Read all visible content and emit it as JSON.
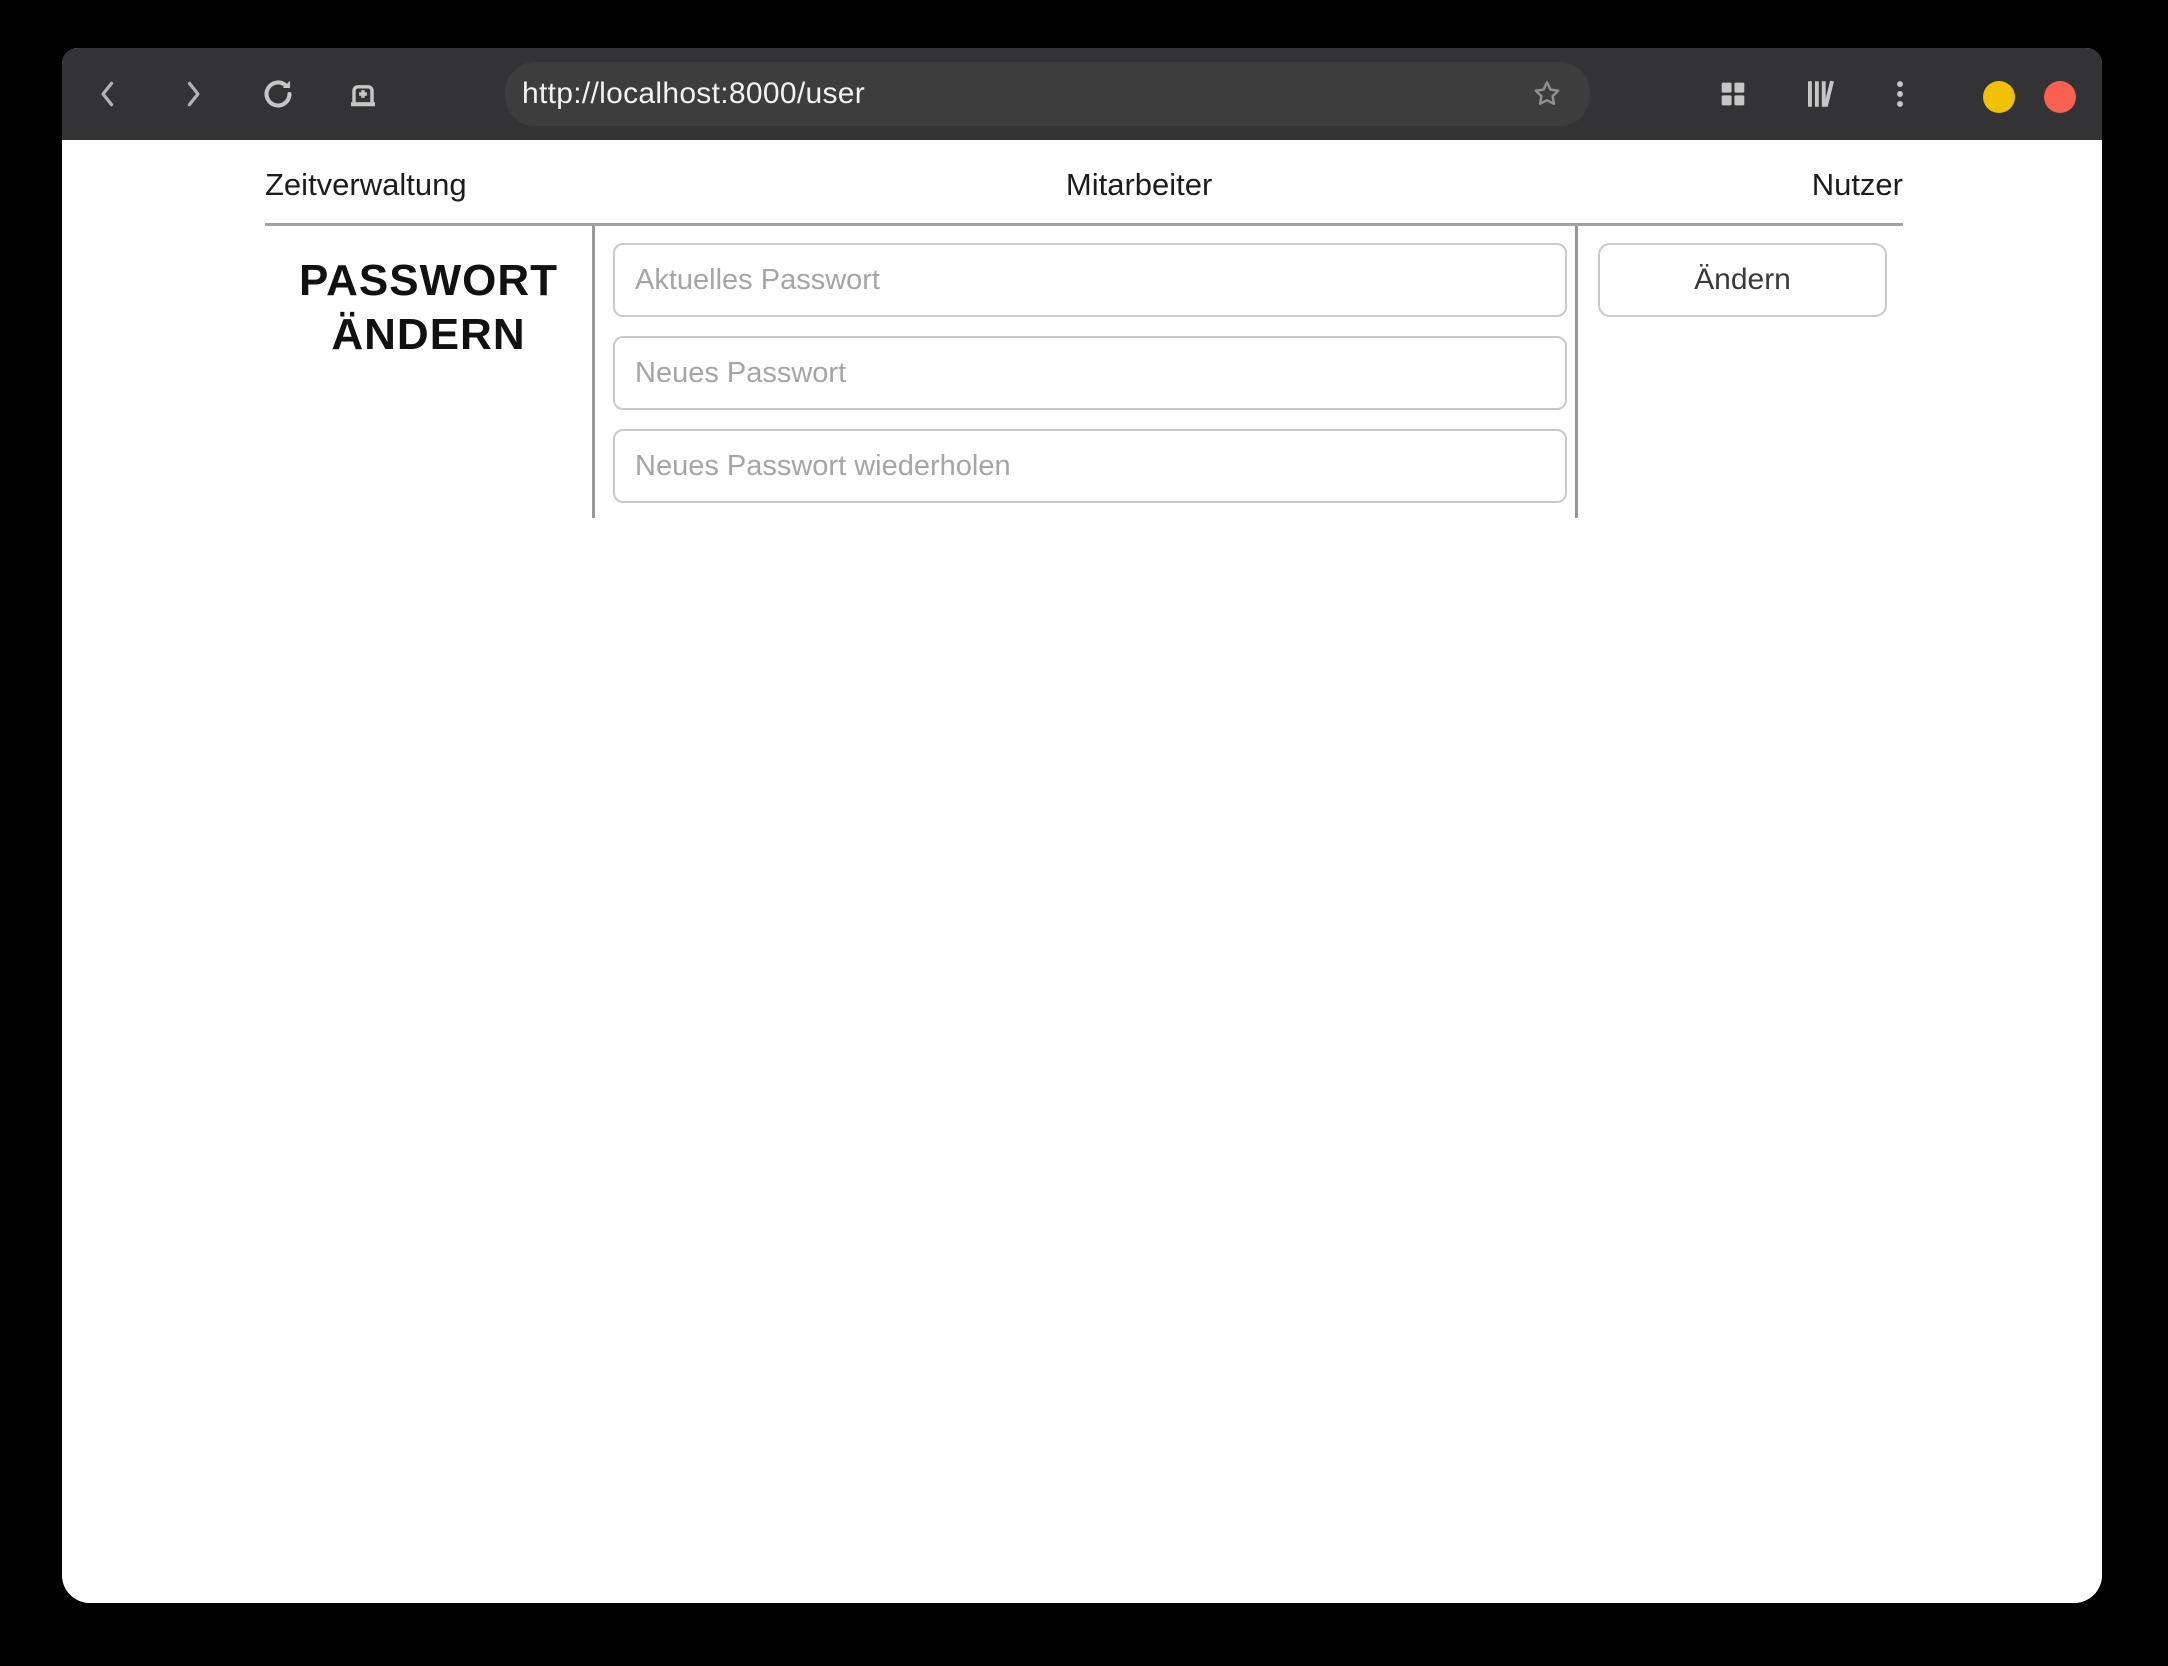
{
  "browser": {
    "url": "http://localhost:8000/user"
  },
  "nav": {
    "items": [
      {
        "label": "Zeitverwaltung"
      },
      {
        "label": "Mitarbeiter"
      },
      {
        "label": "Nutzer"
      }
    ]
  },
  "password": {
    "heading_line1": "PASSWORT",
    "heading_line2": "ÄNDERN",
    "fields": [
      {
        "placeholder": "Aktuelles Passwort",
        "value": ""
      },
      {
        "placeholder": "Neues Passwort",
        "value": ""
      },
      {
        "placeholder": "Neues Passwort wiederholen",
        "value": ""
      }
    ],
    "submit_label": "Ändern"
  },
  "icons": {
    "toolbar_left": [
      "back-icon",
      "forward-icon",
      "reload-icon",
      "new-tab-icon"
    ],
    "urlbar": [
      "bookmark-star-icon"
    ],
    "toolbar_right": [
      "tab-grid-icon",
      "library-icon",
      "kebab-menu-icon"
    ],
    "window_controls": [
      "minimize-circle",
      "close-circle"
    ]
  },
  "colors": {
    "toolbar_bg": "#333234",
    "urlbar_bg": "#3d3d3e",
    "minimize_button": "#f3c000",
    "close_button": "#f66151",
    "divider": "#999999"
  }
}
